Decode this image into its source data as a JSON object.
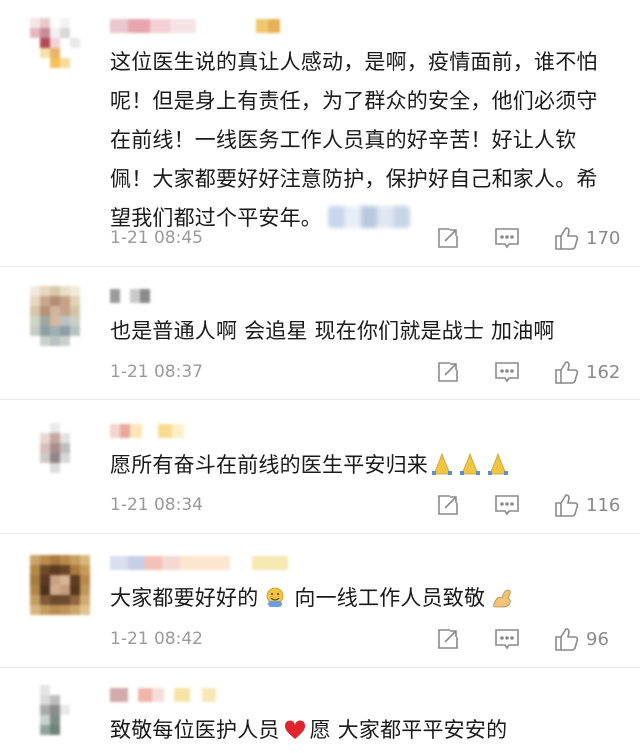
{
  "comments": [
    {
      "text": "这位医生说的真让人感动，是啊，疫情面前，谁不怕呢！但是身上有责任，为了群众的安全，他们必须守在前线！一线医务工作人员真的好辛苦！好让人钦佩！大家都要好好注意防护，保护好自己和家人。希望我们都过个平安年。",
      "time": "1-21 08:45",
      "likes": "170"
    },
    {
      "text": "也是普通人啊 会追星 现在你们就是战士 加油啊",
      "time": "1-21 08:37",
      "likes": "162"
    },
    {
      "text": "愿所有奋斗在前线的医生平安归来",
      "time": "1-21 08:34",
      "likes": "116"
    },
    {
      "text_a": "大家都要好好的",
      "text_b": "向一线工作人员致敬",
      "time": "1-21 08:42",
      "likes": "96"
    },
    {
      "text_a": "致敬每位医护人员",
      "text_b": "愿 大家都平平安安的"
    }
  ],
  "icons": {
    "repost": "repost-icon",
    "comment": "comment-icon",
    "like": "thumbs-up-icon"
  },
  "colors": {
    "time": "#9a9a9a",
    "icon": "#8a8a8a",
    "divider": "#ececec"
  }
}
